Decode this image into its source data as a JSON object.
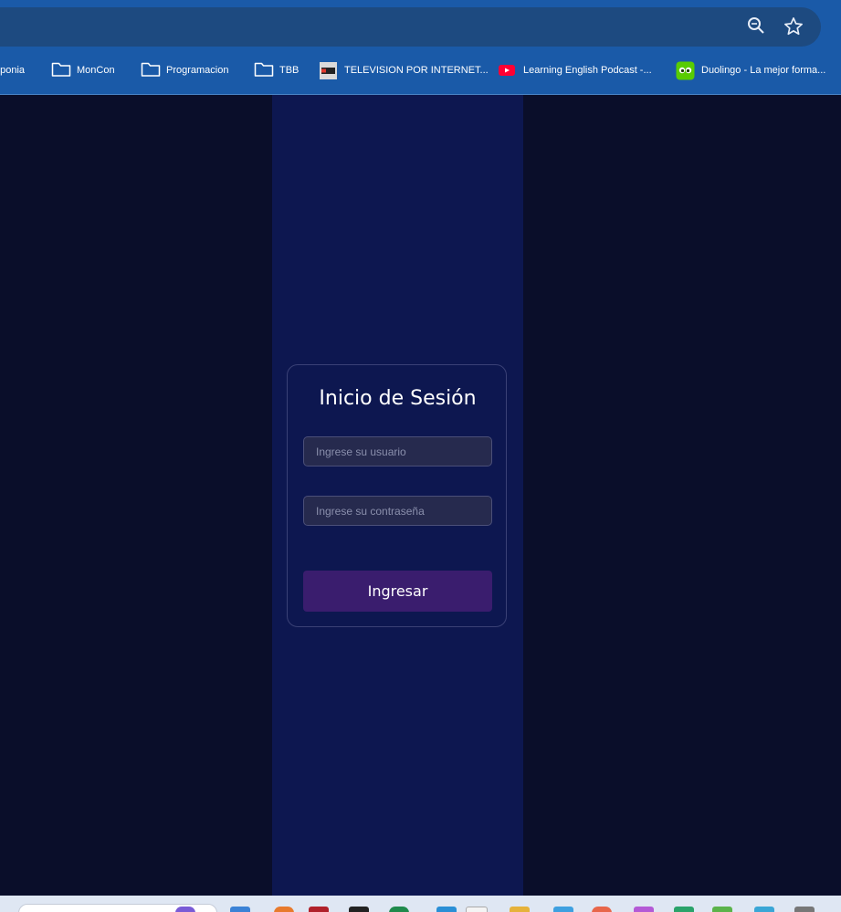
{
  "browser": {
    "icons": [
      "zoom-icon",
      "star-icon"
    ],
    "bookmarks": [
      {
        "label": "pponia",
        "icon": "none"
      },
      {
        "label": "MonCon",
        "icon": "folder-icon"
      },
      {
        "label": "Programacion",
        "icon": "folder-icon"
      },
      {
        "label": "TBB",
        "icon": "folder-icon"
      },
      {
        "label": "TELEVISION POR INTERNET...",
        "icon": "tvplus-icon"
      },
      {
        "label": "Learning English Podcast -...",
        "icon": "youtube-icon"
      },
      {
        "label": "Duolingo - La mejor forma...",
        "icon": "duolingo-icon"
      }
    ]
  },
  "login": {
    "title": "Inicio de Sesión",
    "username_placeholder": "Ingrese su usuario",
    "username_value": "",
    "password_placeholder": "Ingrese su contraseña",
    "password_value": "",
    "submit_label": "Ingresar"
  },
  "colors": {
    "background": "#0a0e2a",
    "column": "#0d1750",
    "button": "#3a1d6e",
    "browser_frame": "#1a5aa8"
  }
}
